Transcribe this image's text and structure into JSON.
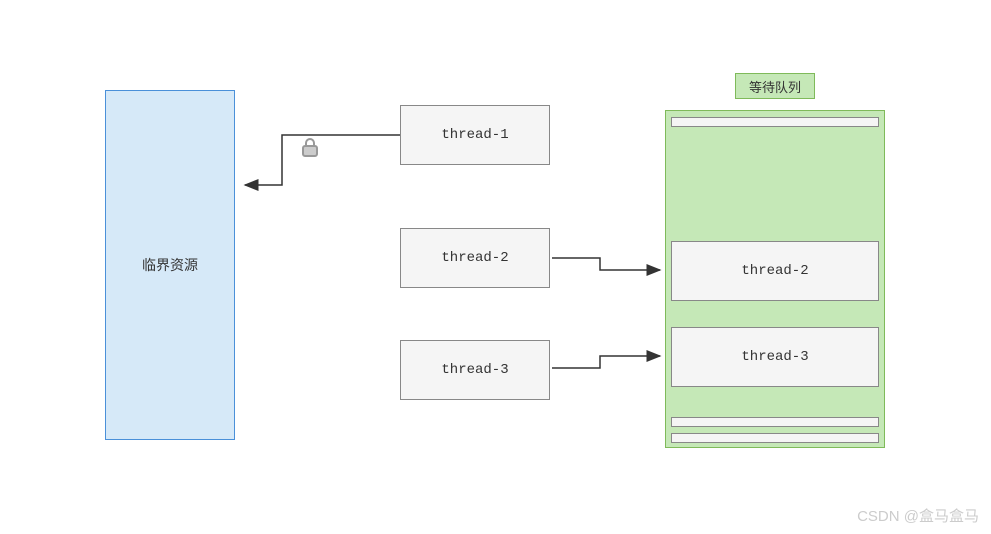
{
  "critical_resource": {
    "label": "临界资源"
  },
  "threads": {
    "t1": {
      "label": "thread-1"
    },
    "t2": {
      "label": "thread-2"
    },
    "t3": {
      "label": "thread-3"
    }
  },
  "queue": {
    "title": "等待队列",
    "slots": {
      "s2": {
        "label": "thread-2"
      },
      "s3": {
        "label": "thread-3"
      }
    }
  },
  "icons": {
    "lock": "lock-icon"
  },
  "watermark": "CSDN @盒马盒马"
}
